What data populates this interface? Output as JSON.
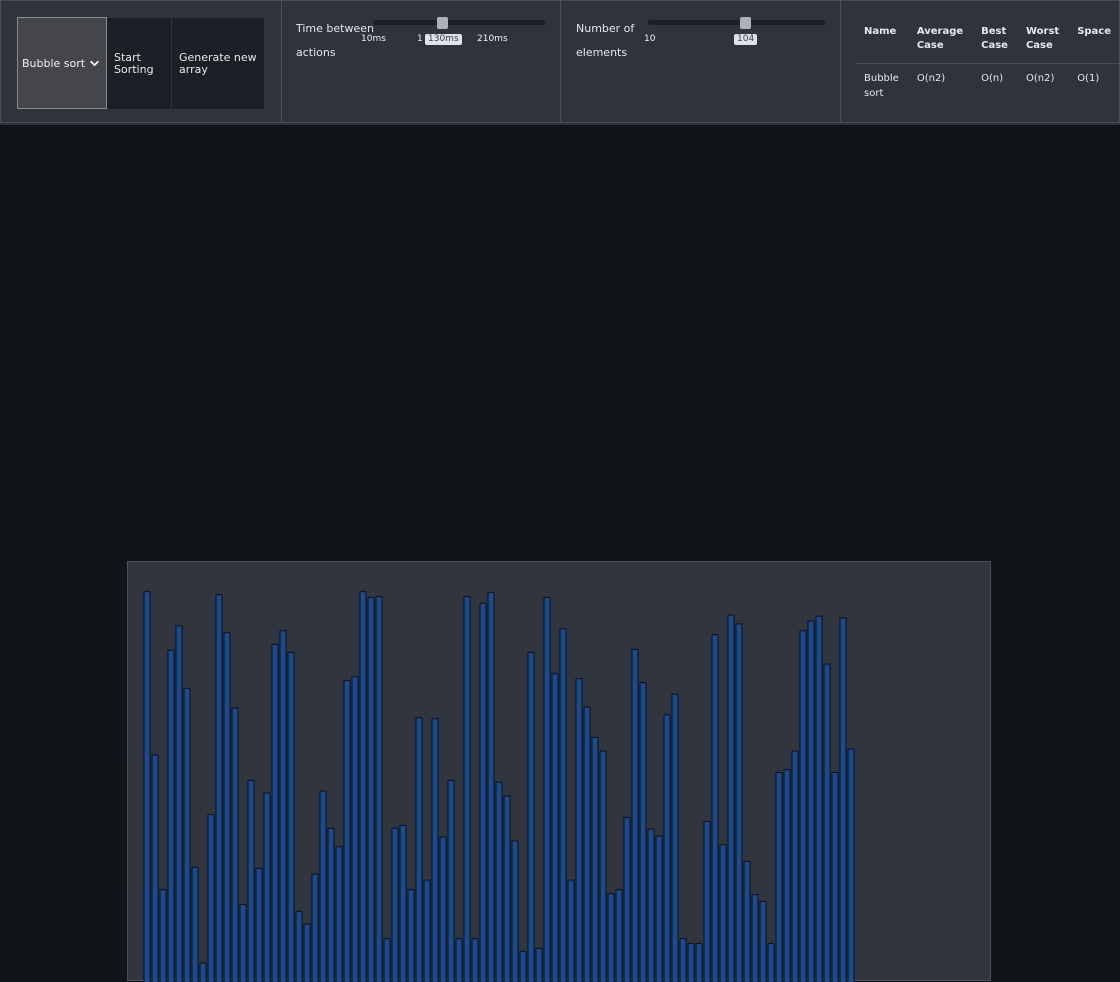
{
  "controls": {
    "algorithm_select": {
      "selected": "Bubble sort"
    },
    "start_button": "Start Sorting",
    "generate_button": "Generate new array"
  },
  "delay_slider": {
    "label": "Time between actions",
    "min_label": "10ms",
    "mid_label": "1",
    "max_label": "210ms",
    "value_label": "130ms",
    "value": 130,
    "min": 10,
    "max": 210
  },
  "count_slider": {
    "label": "Number of elements",
    "min_label": "10",
    "value_label": "104",
    "value": 104,
    "min": 10,
    "max": 200
  },
  "complexity_table": {
    "headers": [
      "Name",
      "Average Case",
      "Best Case",
      "Worst Case",
      "Space"
    ],
    "rows": [
      [
        "Bubble sort",
        "O(n2)",
        "O(n)",
        "O(n2)",
        "O(1)"
      ]
    ]
  },
  "colors": {
    "bar_fill": "#1b4a8e",
    "bar_stroke": "#0b1020",
    "background": "#111418"
  },
  "chart_data": {
    "type": "bar",
    "ylim": [
      0,
      400
    ],
    "values": [
      385,
      218,
      80,
      325,
      350,
      286,
      103,
      5,
      157,
      382,
      343,
      266,
      65,
      192,
      102,
      179,
      331,
      345,
      323,
      58,
      45,
      96,
      181,
      143,
      124,
      294,
      298,
      385,
      379,
      380,
      30,
      143,
      146,
      80,
      256,
      90,
      255,
      134,
      192,
      30,
      380,
      30,
      373,
      384,
      190,
      176,
      130,
      17,
      323,
      20,
      379,
      301,
      347,
      90,
      296,
      267,
      236,
      222,
      76,
      80,
      154,
      326,
      292,
      142,
      135,
      259,
      280,
      30,
      25,
      25,
      150,
      341,
      126,
      361,
      352,
      109,
      75,
      68,
      25,
      200,
      203,
      222,
      345,
      355,
      360,
      311,
      200,
      358,
      224
    ],
    "comment": "bar heights in arbitrary value units (unsorted array being visualized)"
  }
}
